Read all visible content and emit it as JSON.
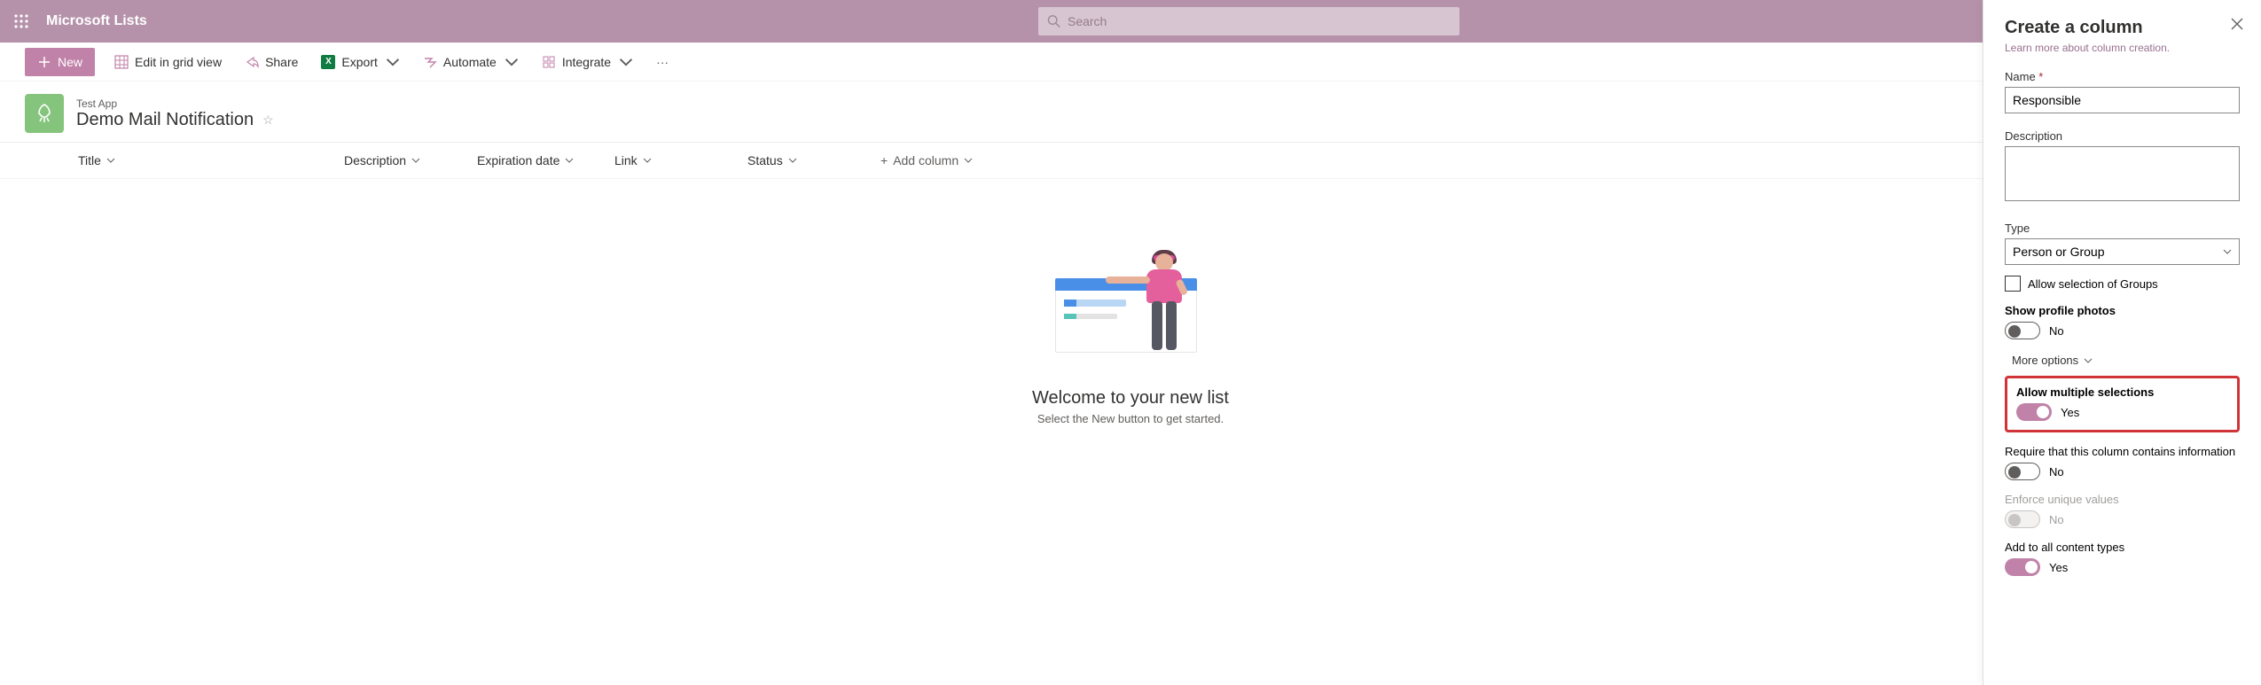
{
  "suite": {
    "app_name": "Microsoft Lists",
    "search_placeholder": "Search"
  },
  "commands": {
    "new": "New",
    "grid": "Edit in grid view",
    "share": "Share",
    "export": "Export",
    "automate": "Automate",
    "integrate": "Integrate"
  },
  "list": {
    "app_label": "Test App",
    "title": "Demo Mail Notification"
  },
  "columns": {
    "title": "Title",
    "description": "Description",
    "expiration": "Expiration date",
    "link": "Link",
    "status": "Status",
    "add": "Add column"
  },
  "empty": {
    "heading": "Welcome to your new list",
    "sub": "Select the New button to get started."
  },
  "panel": {
    "title": "Create a column",
    "learn_link": "Learn more about column creation.",
    "name_label": "Name",
    "name_value": "Responsible",
    "desc_label": "Description",
    "desc_value": "",
    "type_label": "Type",
    "type_value": "Person or Group",
    "allow_groups_label": "Allow selection of Groups",
    "show_photos_label": "Show profile photos",
    "show_photos_value": "No",
    "more_options": "More options",
    "allow_multi_label": "Allow multiple selections",
    "allow_multi_value": "Yes",
    "require_label": "Require that this column contains information",
    "require_value": "No",
    "unique_label": "Enforce unique values",
    "unique_value": "No",
    "all_ct_label": "Add to all content types",
    "all_ct_value": "Yes"
  }
}
